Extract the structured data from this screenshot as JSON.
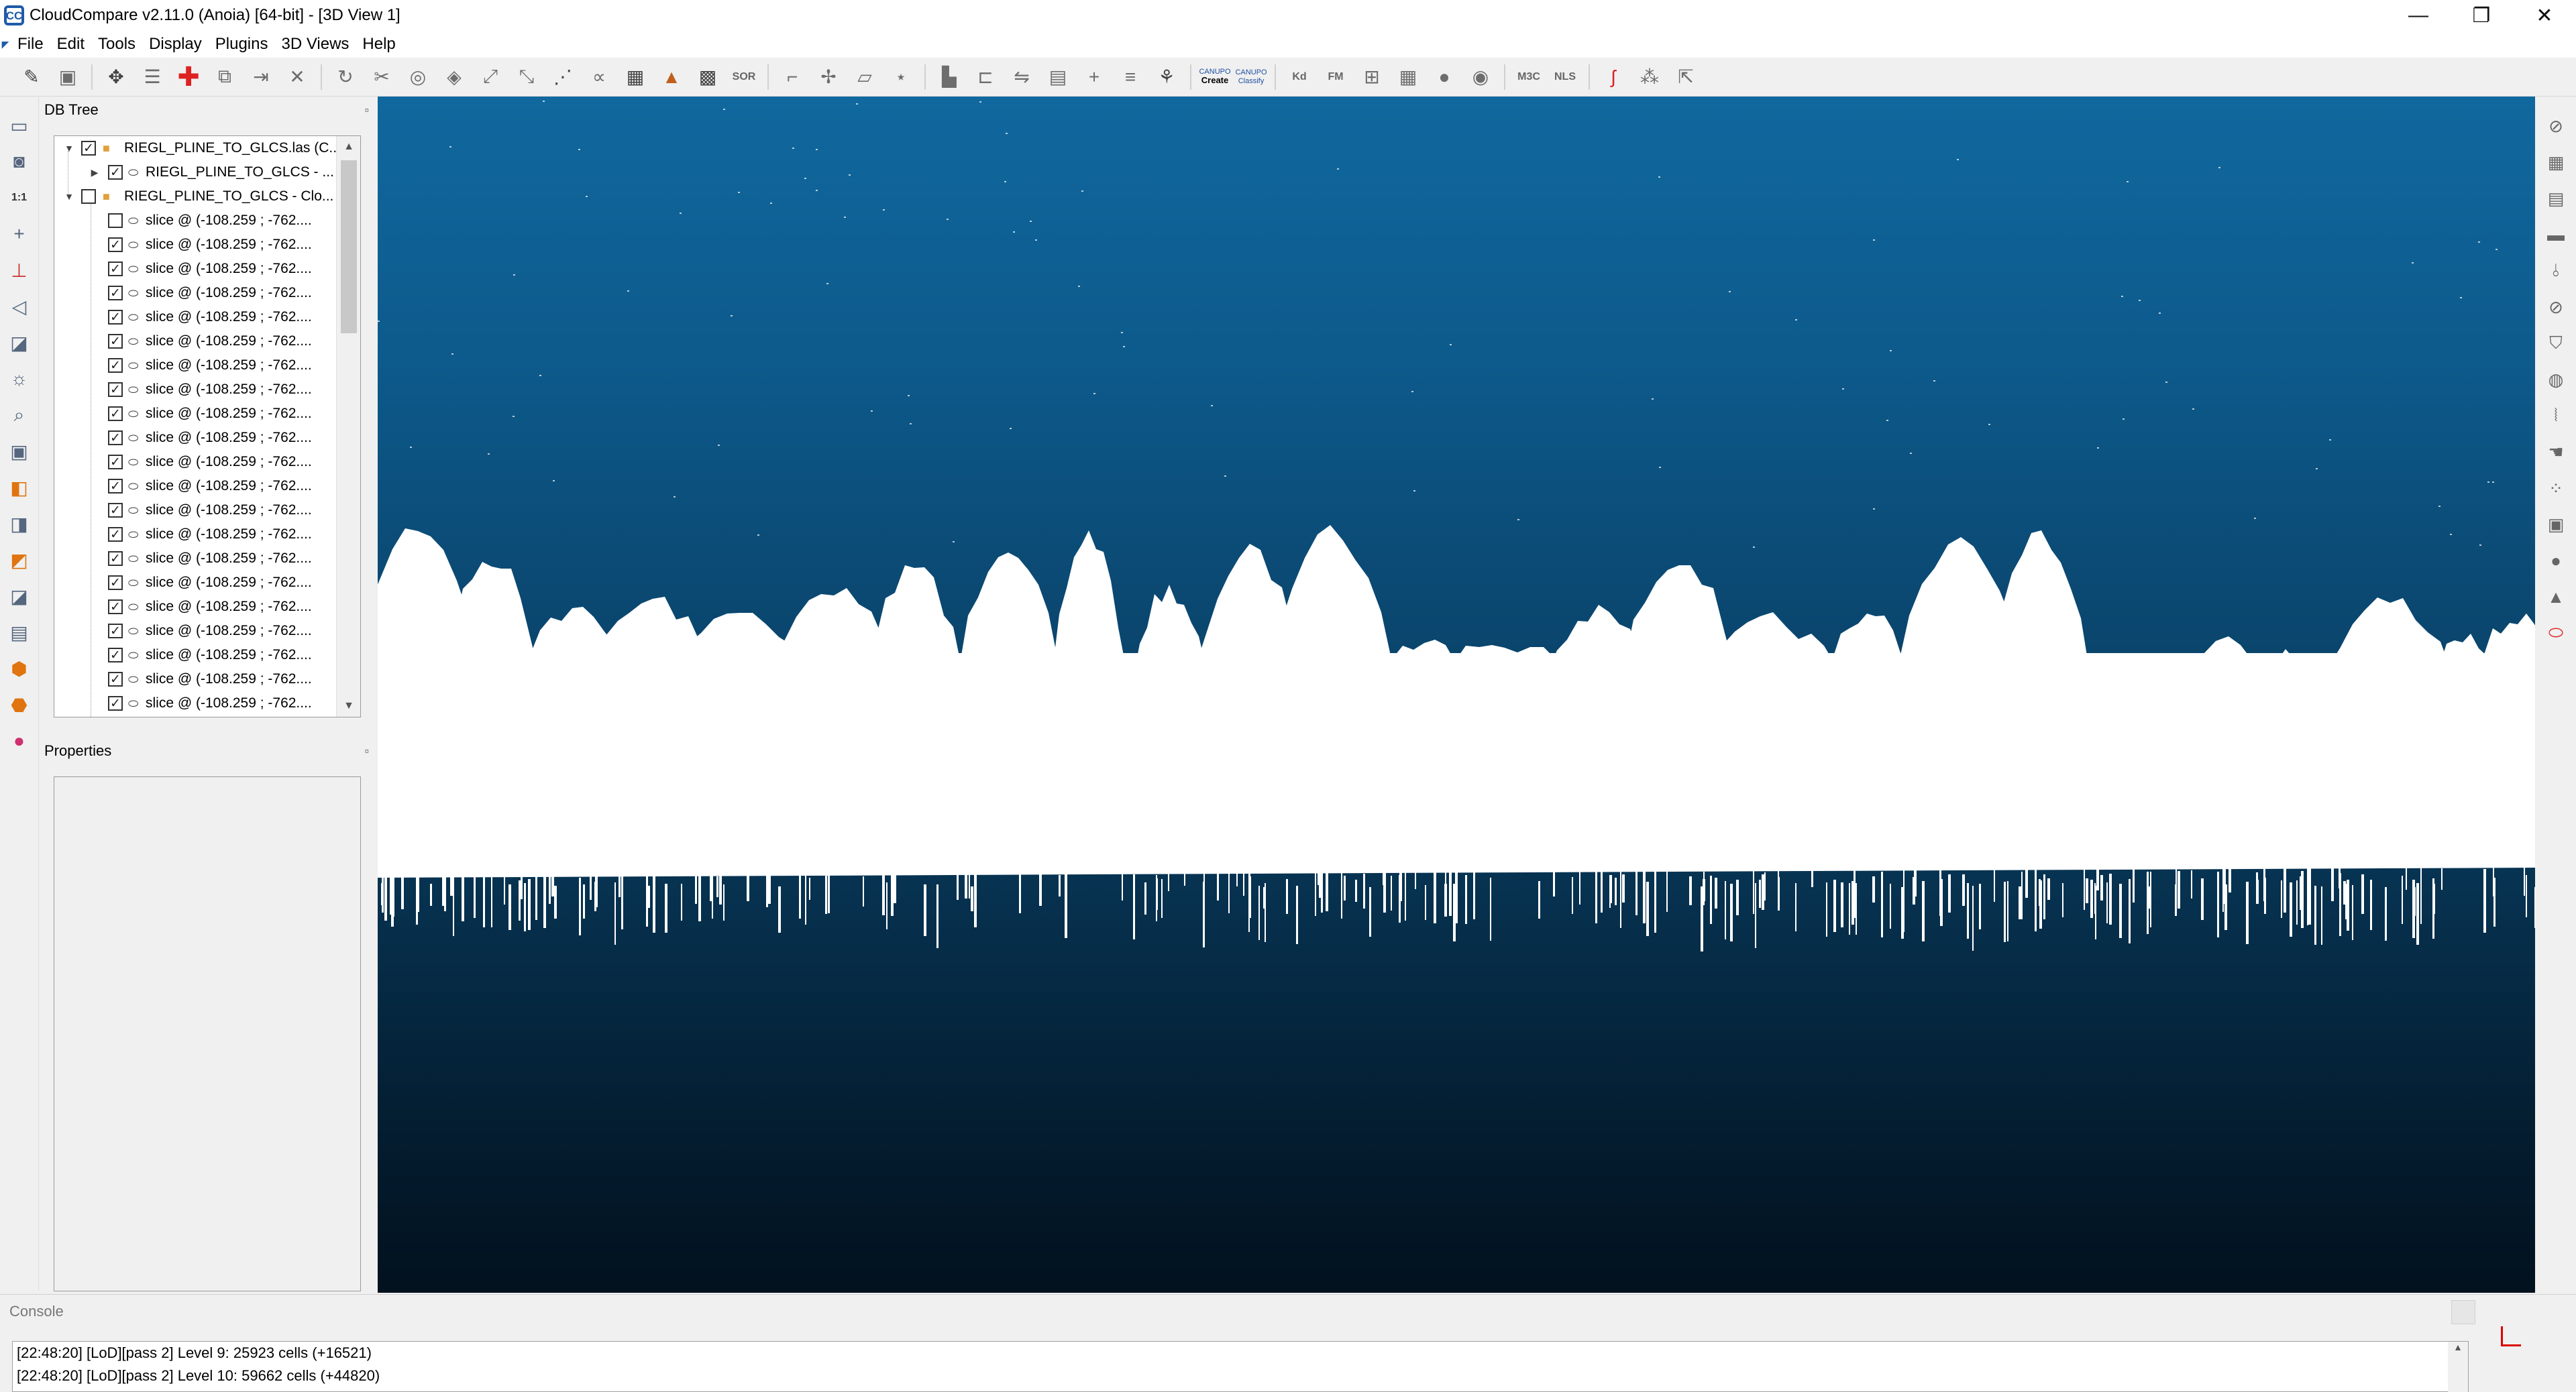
{
  "window": {
    "title": "CloudCompare v2.11.0 (Anoia) [64-bit] - [3D View 1]",
    "logo_text": "CC",
    "controls": {
      "minimize": "—",
      "restore": "❐",
      "close": "✕"
    }
  },
  "menu": {
    "items": [
      "File",
      "Edit",
      "Tools",
      "Display",
      "Plugins",
      "3D Views",
      "Help"
    ]
  },
  "toolbar": {
    "sor_label": "SOR",
    "kd_label": "Kd",
    "fm_label": "FM",
    "mc_label": "M3C",
    "nls_label": "NLS",
    "canupo_create": {
      "top": "CANUPO",
      "bottom": "Create"
    },
    "canupo_classify": {
      "top": "CANUPO",
      "bottom": "Classify"
    }
  },
  "db_tree": {
    "title": "DB Tree",
    "pin": "▫",
    "root1": {
      "label": "RIEGL_PLINE_TO_GLCS.las (C...",
      "checked": true
    },
    "root1_child": {
      "label": "RIEGL_PLINE_TO_GLCS - ...",
      "checked": true
    },
    "root2": {
      "label": "RIEGL_PLINE_TO_GLCS - Clo...",
      "checked": false
    },
    "slices": [
      {
        "label": "slice @ (-108.259 ; -762....",
        "checked": false
      },
      {
        "label": "slice @ (-108.259 ; -762....",
        "checked": true
      },
      {
        "label": "slice @ (-108.259 ; -762....",
        "checked": true
      },
      {
        "label": "slice @ (-108.259 ; -762....",
        "checked": true
      },
      {
        "label": "slice @ (-108.259 ; -762....",
        "checked": true
      },
      {
        "label": "slice @ (-108.259 ; -762....",
        "checked": true
      },
      {
        "label": "slice @ (-108.259 ; -762....",
        "checked": true
      },
      {
        "label": "slice @ (-108.259 ; -762....",
        "checked": true
      },
      {
        "label": "slice @ (-108.259 ; -762....",
        "checked": true
      },
      {
        "label": "slice @ (-108.259 ; -762....",
        "checked": true
      },
      {
        "label": "slice @ (-108.259 ; -762....",
        "checked": true
      },
      {
        "label": "slice @ (-108.259 ; -762....",
        "checked": true
      },
      {
        "label": "slice @ (-108.259 ; -762....",
        "checked": true
      },
      {
        "label": "slice @ (-108.259 ; -762....",
        "checked": true
      },
      {
        "label": "slice @ (-108.259 ; -762....",
        "checked": true
      },
      {
        "label": "slice @ (-108.259 ; -762....",
        "checked": true
      },
      {
        "label": "slice @ (-108.259 ; -762....",
        "checked": true
      },
      {
        "label": "slice @ (-108.259 ; -762....",
        "checked": true
      },
      {
        "label": "slice @ (-108.259 ; -762....",
        "checked": true
      },
      {
        "label": "slice @ (-108.259 ; -762....",
        "checked": true
      },
      {
        "label": "slice @ (-108.259 ; -762....",
        "checked": true
      }
    ]
  },
  "properties": {
    "title": "Properties",
    "pin": "▫"
  },
  "view": {
    "sky_color": "#0d5a8c",
    "points_color": "#ffffff"
  },
  "console": {
    "title": "Console",
    "lines": [
      "[22:48:20] [LoD][pass 2] Level 9: 25923 cells (+16521)",
      "[22:48:20] [LoD][pass 2] Level 10: 59662 cells (+44820)"
    ]
  }
}
